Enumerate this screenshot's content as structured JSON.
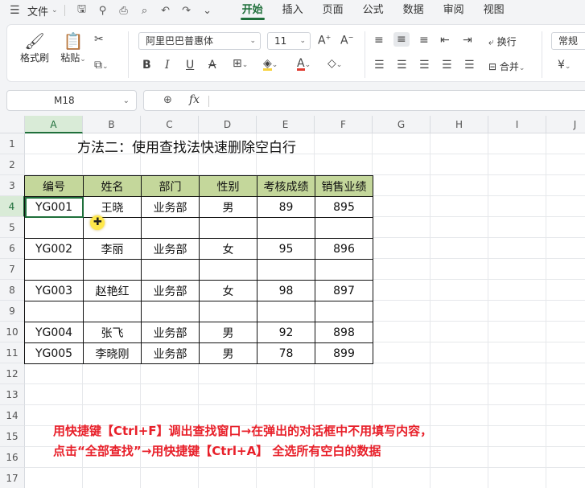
{
  "menubar": {
    "file_label": "文件",
    "tabs": [
      "开始",
      "插入",
      "页面",
      "公式",
      "数据",
      "审阅",
      "视图"
    ],
    "active_tab": "开始"
  },
  "ribbon": {
    "format_painter": "格式刷",
    "paste": "粘贴",
    "font_name": "阿里巴巴普惠体",
    "font_size": "11",
    "wrap_text": "换行",
    "merge": "合并",
    "number_format": "常规",
    "currency_symbol": "¥"
  },
  "formula_bar": {
    "cell_ref": "M18",
    "fx_label": "fx",
    "formula": ""
  },
  "grid": {
    "columns": [
      "A",
      "B",
      "C",
      "D",
      "E",
      "F",
      "G",
      "H",
      "I",
      "J"
    ],
    "rows": [
      "1",
      "2",
      "3",
      "4",
      "5",
      "6",
      "7",
      "8",
      "9",
      "10",
      "11",
      "12",
      "13",
      "14",
      "15",
      "16",
      "17"
    ]
  },
  "sheet": {
    "title": "方法二：使用查找法快速删除空白行",
    "headers": [
      "编号",
      "姓名",
      "部门",
      "性别",
      "考核成绩",
      "销售业绩"
    ],
    "rows": [
      [
        "YG001",
        "王晓",
        "业务部",
        "男",
        "89",
        "895"
      ],
      [
        "",
        "",
        "",
        "",
        "",
        ""
      ],
      [
        "YG002",
        "李丽",
        "业务部",
        "女",
        "95",
        "896"
      ],
      [
        "",
        "",
        "",
        "",
        "",
        ""
      ],
      [
        "YG003",
        "赵艳红",
        "业务部",
        "女",
        "98",
        "897"
      ],
      [
        "",
        "",
        "",
        "",
        "",
        ""
      ],
      [
        "YG004",
        "张飞",
        "业务部",
        "男",
        "92",
        "898"
      ],
      [
        "YG005",
        "李晓刚",
        "业务部",
        "男",
        "78",
        "899"
      ]
    ]
  },
  "instruction": {
    "line1": "用快捷键【Ctrl+F】调出查找窗口→在弹出的对话框中不用填写内容，",
    "line2": "点击“全部查找”→用快捷键【Ctrl+A】 全选所有空白的数据"
  },
  "colors": {
    "accent": "#1f6f3b",
    "header_fill": "#c4d79b",
    "note": "#e8202a"
  }
}
